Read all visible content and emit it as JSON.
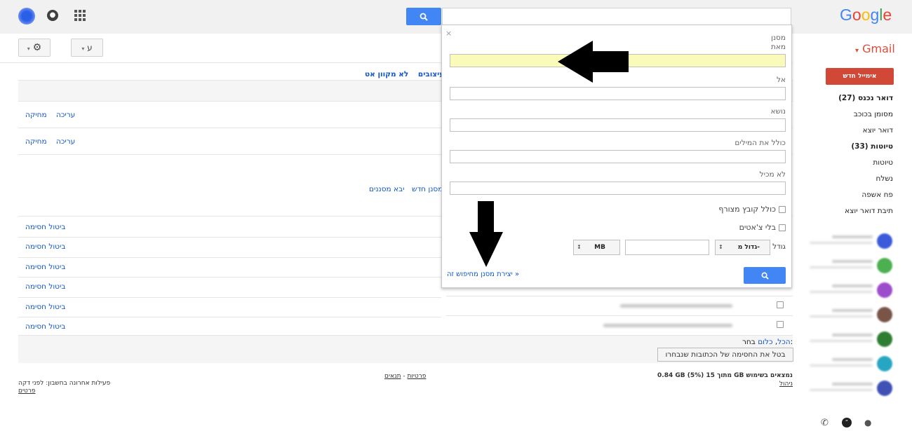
{
  "header": {
    "logo": "Google",
    "gmail_label": "Gmail",
    "gmail_caret": "▾"
  },
  "toolbar": {
    "lang_btn": "ע",
    "caret": "▾"
  },
  "sidebar": {
    "compose": "אימייל חדש",
    "items": [
      {
        "label": "דואר נכנס (27)",
        "bold": true
      },
      {
        "label": "מסומן בכוכב",
        "bold": false
      },
      {
        "label": "דואר יוצא",
        "bold": false
      },
      {
        "label": "טיוטות (33)",
        "bold": true
      },
      {
        "label": "טיוטות",
        "bold": false
      },
      {
        "label": "נשלח",
        "bold": false
      },
      {
        "label": "פח אשפה",
        "bold": false
      },
      {
        "label": "תיבת דואר יוצא",
        "bold": false
      }
    ],
    "contact_colors": [
      "#3b5bdb",
      "#4caf50",
      "#9c4dcc",
      "#795548",
      "#2e7d32",
      "#26a6c2",
      "#3f51b5"
    ]
  },
  "settings_tabs": {
    "items": [
      "עיצובים",
      "לא מקוון",
      "אט"
    ]
  },
  "main": {
    "row_actions": {
      "edit": "עריכה",
      "delete": "מחיקה"
    },
    "filter_links": {
      "new_filter": "מסנן חדש",
      "import": "יבא מסננים"
    },
    "unblock_label": "ביטול חסימה",
    "select_label": "בחר:",
    "select_all": "הכל",
    "select_none": "כלום",
    "unblock_selected_btn": "בטל את החסימה של הכתובות שנבחרו"
  },
  "filter_panel": {
    "close": "×",
    "title": "מסנן",
    "from_label": "מאת",
    "to_label": "אל",
    "subject_label": "נושא",
    "has_words_label": "כולל את המילים",
    "not_has_label": "לא מכיל",
    "has_attachment": "כולל קובץ מצורף",
    "no_chats": "בלי צ'אטים",
    "size_label": "גודל",
    "size_op": "גדול מ-",
    "size_unit": "MB",
    "create_filter_link": "יצירת מסנן מחיפוש זה »"
  },
  "footer": {
    "storage": "0.84 GB (5%) מתוך 15 GB נמצאים בשימוש",
    "manage": "ניהול",
    "terms": "תנאים",
    "privacy": "פרטיות",
    "separator": " - ",
    "last_activity": "פעילות אחרונה בחשבון: לפני דקה",
    "details": "פרטים"
  }
}
